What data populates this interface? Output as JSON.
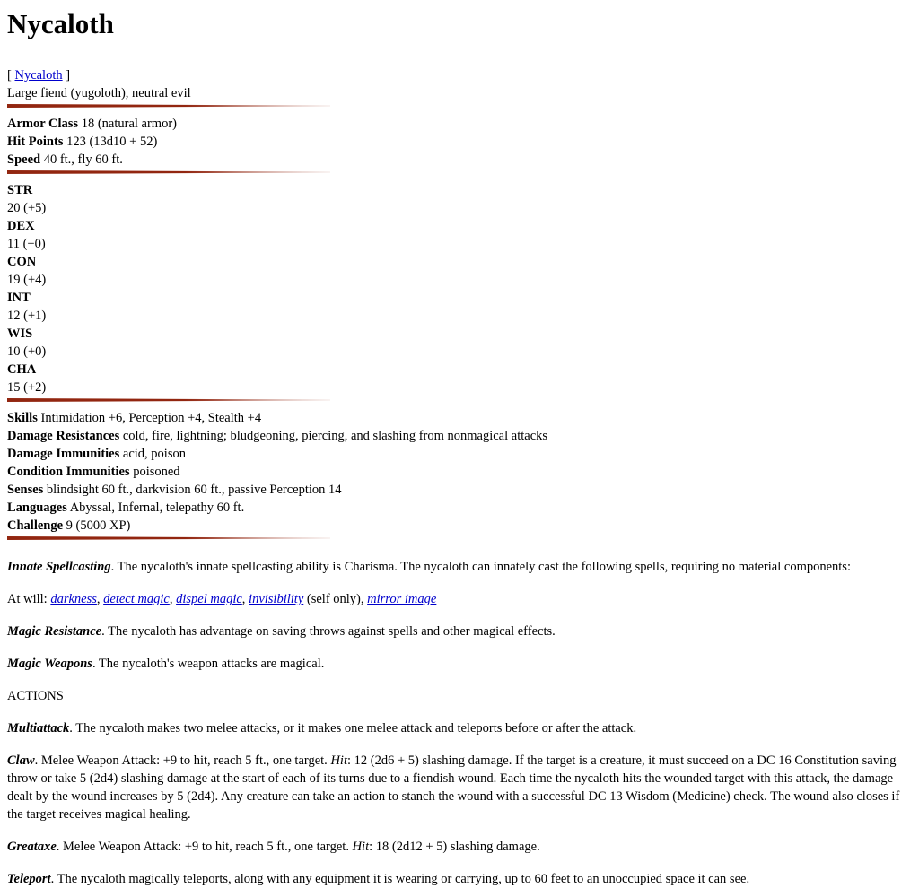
{
  "title": "Nycaloth",
  "source": {
    "open": "[ ",
    "link": "Nycaloth",
    "close": " ]"
  },
  "type_line": "Large fiend (yugoloth), neutral evil",
  "defense": [
    {
      "label": "Armor Class",
      "value": " 18 (natural armor)"
    },
    {
      "label": "Hit Points",
      "value": " 123 (13d10 + 52)"
    },
    {
      "label": "Speed",
      "value": " 40 ft., fly 60 ft."
    }
  ],
  "abilities": [
    {
      "name": "STR",
      "value": "20 (+5)"
    },
    {
      "name": "DEX",
      "value": "11 (+0)"
    },
    {
      "name": "CON",
      "value": "19 (+4)"
    },
    {
      "name": "INT",
      "value": "12 (+1)"
    },
    {
      "name": "WIS",
      "value": "10 (+0)"
    },
    {
      "name": "CHA",
      "value": "15 (+2)"
    }
  ],
  "properties": [
    {
      "label": "Skills",
      "value": " Intimidation +6, Perception +4, Stealth +4"
    },
    {
      "label": "Damage Resistances",
      "value": " cold, fire, lightning; bludgeoning, piercing, and slashing from nonmagical attacks"
    },
    {
      "label": "Damage Immunities",
      "value": " acid, poison"
    },
    {
      "label": "Condition Immunities",
      "value": " poisoned"
    },
    {
      "label": "Senses",
      "value": " blindsight 60 ft., darkvision 60 ft., passive Perception 14"
    },
    {
      "label": "Languages",
      "value": " Abyssal, Infernal, telepathy 60 ft."
    },
    {
      "label": "Challenge",
      "value": " 9 (5000 XP)"
    }
  ],
  "traits": {
    "innate": {
      "name": "Innate Spellcasting",
      "text": ". The nycaloth's innate spellcasting ability is Charisma. The nycaloth can innately cast the following spells, requiring no material components:"
    },
    "at_will": {
      "prefix": "At will: ",
      "spells": [
        "darkness",
        "detect magic",
        "dispel magic",
        "invisibility",
        "mirror image"
      ],
      "sep": ", ",
      "invis_note": " (self only)"
    },
    "magic_resistance": {
      "name": "Magic Resistance",
      "text": ". The nycaloth has advantage on saving throws against spells and other magical effects."
    },
    "magic_weapons": {
      "name": "Magic Weapons",
      "text": ". The nycaloth's weapon attacks are magical."
    }
  },
  "actions_header": "ACTIONS",
  "actions": {
    "multiattack": {
      "name": "Multiattack",
      "text": ". The nycaloth makes two melee attacks, or it makes one melee attack and teleports before or after the attack."
    },
    "claw": {
      "name": "Claw",
      "text1": ". Melee Weapon Attack: +9 to hit, reach 5 ft., one target. ",
      "hit": "Hit",
      "text2": ": 12 (2d6 + 5) slashing damage. If the target is a creature, it must succeed on a DC 16 Constitution saving throw or take 5 (2d4) slashing damage at the start of each of its turns due to a fiendish wound. Each time the nycaloth hits the wounded target with this attack, the damage dealt by the wound increases by 5 (2d4). Any creature can take an action to stanch the wound with a successful DC 13 Wisdom (Medicine) check. The wound also closes if the target receives magical healing."
    },
    "greataxe": {
      "name": "Greataxe",
      "text1": ". Melee Weapon Attack: +9 to hit, reach 5 ft., one target. ",
      "hit": "Hit",
      "text2": ": 18 (2d12 + 5) slashing damage."
    },
    "teleport": {
      "name": "Teleport",
      "text": ". The nycaloth magically teleports, along with any equipment it is wearing or carrying, up to 60 feet to an unoccupied space it can see."
    }
  }
}
